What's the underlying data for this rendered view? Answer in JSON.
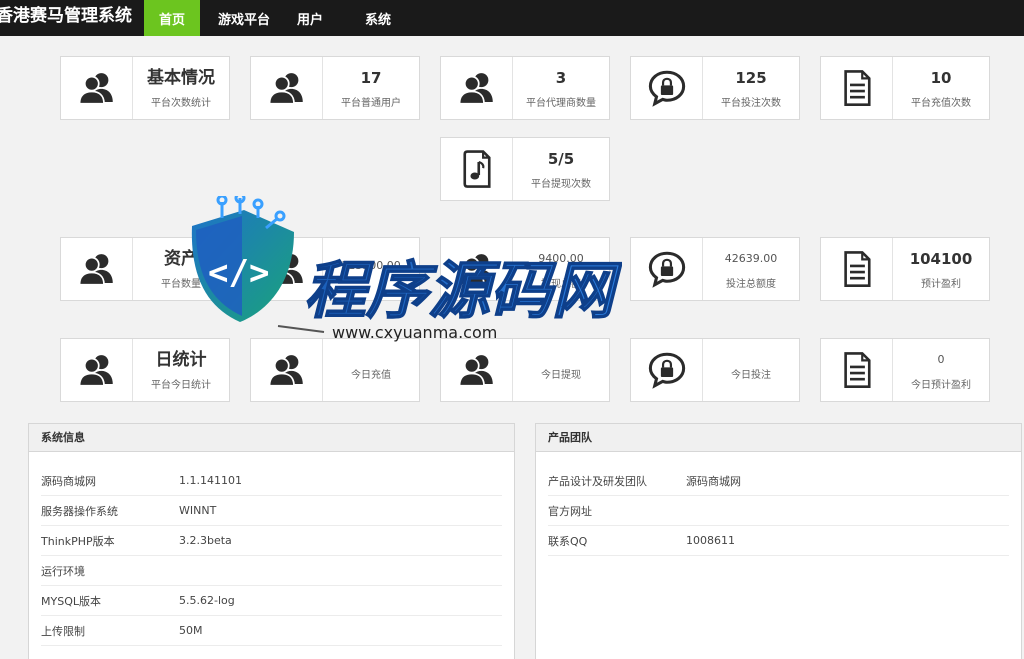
{
  "app": {
    "title": "香港赛马管理系统"
  },
  "nav": [
    {
      "label": "首页",
      "active": true
    },
    {
      "label": "游戏平台",
      "active": false
    },
    {
      "label": "用户",
      "active": false
    },
    {
      "label": "系统",
      "active": false
    }
  ],
  "colors": {
    "accent": "#6cc51f",
    "topbar": "#1a1a1a"
  },
  "cards": {
    "row1": [
      {
        "icon": "users-icon",
        "value": "基本情况",
        "label": "平台次数统计"
      },
      {
        "icon": "users-icon",
        "value": "17",
        "label": "平台普通用户"
      },
      {
        "icon": "users-icon",
        "value": "3",
        "label": "平台代理商数量"
      },
      {
        "icon": "lock-chat-icon",
        "value": "125",
        "label": "平台投注次数"
      },
      {
        "icon": "document-icon",
        "value": "10",
        "label": "平台充值次数"
      }
    ],
    "row2": [
      {
        "icon": "music-file-icon",
        "value": "5/5",
        "label": "平台提现次数"
      }
    ],
    "row3": [
      {
        "icon": "users-icon",
        "value": "资产",
        "label": "平台数量"
      },
      {
        "icon": "users-icon",
        "value": "113500.00",
        "label": ""
      },
      {
        "icon": "users-icon",
        "value": "9400.00",
        "label": "提现总额"
      },
      {
        "icon": "lock-chat-icon",
        "value": "42639.00",
        "label": "投注总额度"
      },
      {
        "icon": "document-icon",
        "value": "104100",
        "label": "预计盈利"
      }
    ],
    "row4": [
      {
        "icon": "users-icon",
        "value": "日统计",
        "label": "平台今日统计"
      },
      {
        "icon": "users-icon",
        "value": "",
        "label": "今日充值"
      },
      {
        "icon": "users-icon",
        "value": "",
        "label": "今日提现"
      },
      {
        "icon": "lock-chat-icon",
        "value": "",
        "label": "今日投注"
      },
      {
        "icon": "document-icon",
        "value": "0",
        "label": "今日预计盈利"
      }
    ]
  },
  "system_panel": {
    "title": "系统信息",
    "rows": [
      {
        "key": "源码商城网",
        "value": "1.1.141101"
      },
      {
        "key": "服务器操作系统",
        "value": "WINNT"
      },
      {
        "key": "ThinkPHP版本",
        "value": "3.2.3beta"
      },
      {
        "key": "运行环境",
        "value": ""
      },
      {
        "key": "MYSQL版本",
        "value": "5.5.62-log"
      },
      {
        "key": "上传限制",
        "value": "50M"
      }
    ]
  },
  "team_panel": {
    "title": "产品团队",
    "rows": [
      {
        "key": "产品设计及研发团队",
        "value": "源码商城网"
      },
      {
        "key": "官方网址",
        "value": ""
      },
      {
        "key": "联系QQ",
        "value": "1008611"
      }
    ]
  },
  "watermark": {
    "title": "程序源码网",
    "url": "www.cxyuanma.com",
    "logo": "code-shield-logo"
  }
}
